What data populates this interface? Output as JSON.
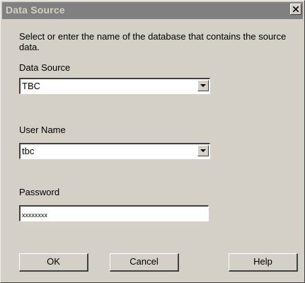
{
  "dialog": {
    "title": "Data Source",
    "close_icon": "close-icon",
    "description": "Select or enter the name of the database that contains the source data."
  },
  "data_source": {
    "label": "Data Source",
    "value": "TBC",
    "dropdown_icon": "chevron-down-icon"
  },
  "user_name": {
    "label": "User Name",
    "value": "tbc",
    "dropdown_icon": "chevron-down-icon"
  },
  "password": {
    "label": "Password",
    "value": "xxxxxxxx"
  },
  "buttons": {
    "ok": "OK",
    "cancel": "Cancel",
    "help": "Help"
  },
  "colors": {
    "dialog_bg": "#d4d0c8",
    "titlebar_bg": "#808080",
    "title_text": "#d4d0c8",
    "field_bg": "#ffffff"
  }
}
